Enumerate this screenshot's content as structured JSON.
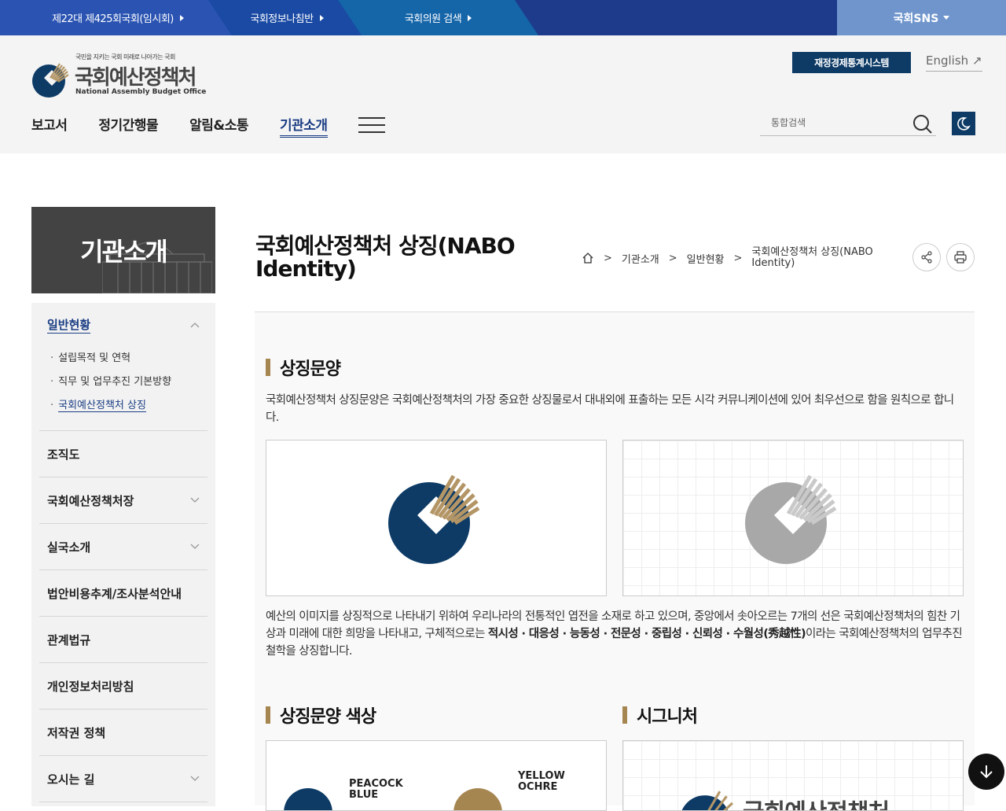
{
  "topbar": {
    "links": [
      "제22대 제425회국회(임시회)",
      "국회정보나침반",
      "국회의원 검색"
    ],
    "sns": "국회SNS"
  },
  "header": {
    "logo_small": "국민을 지키는 국회 미래로 나아가는 국회",
    "logo_name": "국회예산정책처",
    "logo_eng": "National Assembly Budget Office",
    "system_button": "재정경제통계시스템",
    "english": "English",
    "gnb": [
      "보고서",
      "정기간행물",
      "알림&소통",
      "기관소개"
    ],
    "search_placeholder": "통합검색"
  },
  "sidebar": {
    "hero_title": "기관소개",
    "groups": [
      {
        "label": "일반현황",
        "subs": [
          "설립목적 및 연혁",
          "직무 및 업무추진 기본방향",
          "국회예산정책처 상징"
        ]
      },
      {
        "label": "조직도"
      },
      {
        "label": "국회예산정책처장"
      },
      {
        "label": "실국소개"
      },
      {
        "label": "법안비용추계/조사분석안내"
      },
      {
        "label": "관계법규"
      },
      {
        "label": "개인정보처리방침"
      },
      {
        "label": "저작권 정책"
      },
      {
        "label": "오시는 길"
      }
    ]
  },
  "page": {
    "title": "국회예산정책처 상징(NABO Identity)",
    "breadcrumb": [
      "기관소개",
      "일반현황",
      "국회예산정책처 상징(NABO Identity)"
    ],
    "section1_title": "상징문양",
    "section1_desc": "국회예산정책처 상징문양은 국회예산정책처의 가장 중요한 상징물로서 대내외에 표출하는 모든 시각 커뮤니케이션에 있어 최우선으로 함을 원칙으로 합니다.",
    "section1_body_a": "예산의 이미지를 상징적으로 나타내기 위하여 우리나라의 전통적인 엽전을 소재로 하고 있으며, 중앙에서 솟아오르는 7개의 선은 국회예산정책처의 힘찬 기상과 미래에 대한 희망을 나타내고, 구체적으로는 ",
    "section1_body_bold": "적시성 · 대응성 · 능동성 · 전문성 · 중립성 · 신뢰성 · 수월성(秀越性)",
    "section1_body_b": "이라는 국회예산정책처의 업무추진 철학을 상징합니다.",
    "section2_title": "상징문양 색상",
    "section3_title": "시그니처",
    "color1": "PEACOCK BLUE",
    "color2": "YELLOW OCHRE",
    "signature_text": "국회예산정책처"
  },
  "colors": {
    "peacock_blue": "#0d3b66",
    "yellow_ochre": "#a68650",
    "gray": "#a8a8a8"
  }
}
